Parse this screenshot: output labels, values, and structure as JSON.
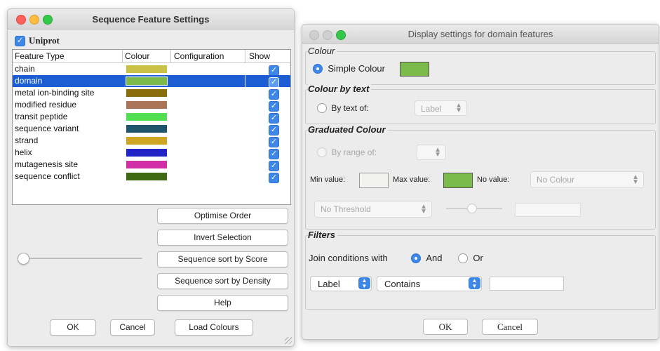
{
  "feature_settings": {
    "title": "Sequence Feature Settings",
    "source_label": "Uniprot",
    "source_checked": true,
    "columns": [
      "Feature Type",
      "Colour",
      "Configuration",
      "Show"
    ],
    "features": [
      {
        "name": "chain",
        "colour": "#c9c247",
        "show": true
      },
      {
        "name": "domain",
        "colour": "#7dba4c",
        "show": true
      },
      {
        "name": "metal ion-binding site",
        "colour": "#8a6d0b",
        "show": true
      },
      {
        "name": "modified residue",
        "colour": "#a97458",
        "show": true
      },
      {
        "name": "transit peptide",
        "colour": "#52e052",
        "show": true
      },
      {
        "name": "sequence variant",
        "colour": "#1f566b",
        "show": true
      },
      {
        "name": "strand",
        "colour": "#cfa524",
        "show": true
      },
      {
        "name": "helix",
        "colour": "#2224c7",
        "show": true
      },
      {
        "name": "mutagenesis site",
        "colour": "#d12fa6",
        "show": true
      },
      {
        "name": "sequence conflict",
        "colour": "#3f6a14",
        "show": true
      }
    ],
    "selected_feature": "domain",
    "buttons": {
      "optimise": "Optimise Order",
      "invert": "Invert Selection",
      "sort_score": "Sequence sort by Score",
      "sort_density": "Sequence sort by Density",
      "help": "Help",
      "ok": "OK",
      "cancel": "Cancel",
      "load_colours": "Load Colours"
    }
  },
  "display_settings": {
    "title": "Display settings for domain features",
    "colour": {
      "legend": "Colour",
      "simple_colour_label": "Simple Colour",
      "simple_colour_selected": true,
      "simple_colour_value": "#7dba4c"
    },
    "colour_by_text": {
      "legend": "Colour by text",
      "by_text_label": "By text of:",
      "attribute": "Label"
    },
    "graduated": {
      "legend": "Graduated Colour",
      "by_range_label": "By range of:",
      "min_label": "Min value:",
      "max_label": "Max value:",
      "no_value_label": "No value:",
      "min_colour": "#f2f2ef",
      "max_colour": "#7dba4c",
      "no_value_option": "No Colour",
      "threshold_option": "No Threshold"
    },
    "filters": {
      "legend": "Filters",
      "join_label": "Join conditions with",
      "and_label": "And",
      "or_label": "Or",
      "join_selected": "And",
      "attribute": "Label",
      "condition": "Contains",
      "pattern": ""
    },
    "buttons": {
      "ok": "OK",
      "cancel": "Cancel"
    }
  }
}
